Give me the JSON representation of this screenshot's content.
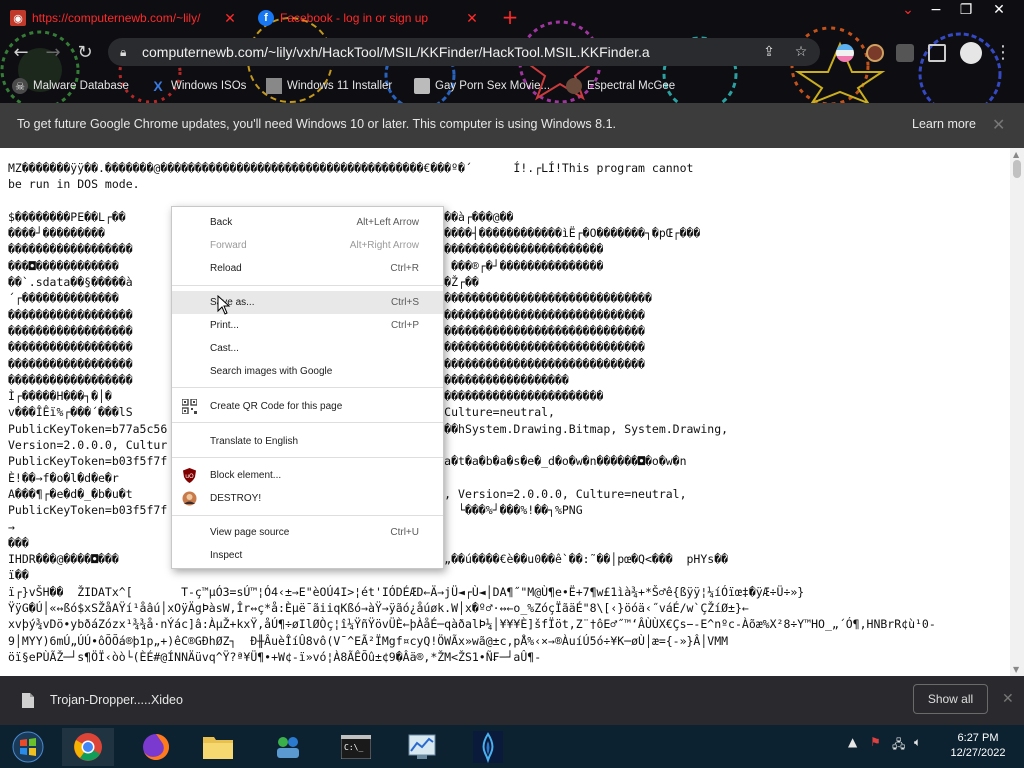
{
  "tabs": [
    {
      "title": "https://computernewb.com/~lily/",
      "favicon": "red-site-icon",
      "active": true
    },
    {
      "title": "Facebook - log in or sign up",
      "favicon": "facebook-icon",
      "active": false
    }
  ],
  "toolbar": {
    "url": "computernewb.com/~lily/vxh/HackTool/MSIL/KKFinder/HackTool.MSIL.KKFinder.a"
  },
  "bookmarks": [
    {
      "label": "Malware Database",
      "icon": "malware-skull-icon"
    },
    {
      "label": "Windows ISOs",
      "icon": "x-logo-icon"
    },
    {
      "label": "Windows 11 Installer",
      "icon": "image-thumb-icon"
    },
    {
      "label": "Gay Porn Sex Movie...",
      "icon": "site-icon"
    },
    {
      "label": "Espectral McGee",
      "icon": "avatar-icon"
    }
  ],
  "infobar": {
    "message": "To get future Google Chrome updates, you'll need Windows 10 or later. This computer is using Windows 8.1.",
    "link": "Learn more"
  },
  "page": {
    "lines": [
      "MZ�������ÿÿ��.�������@��������������������������������������€���º�´      Í!.┌LÍ!This program cannot",
      "be run in DOS mode.",
      "",
      "$��������PE��L┌��                              ��������>ì┌��  ���à┌���@��",
      "����┘���������                             ���┤��┤����┤���┼��������┤������������ìË┌�O�������┐�pŒ┌���",
      "������������������                        ��������������������������������������������",
      "���◘������������                          ����������������┐┬��  ���®┌�┘���������������",
      "��`.sdata��§�����à                        ���À.rsrc���pŒ┌���┐���Ž┌��",
      "´┌��������������                          ���������������@��B��������������������������������",
      "������������������                        ��������������������������������������������������",
      "������������������                        ��������������������������������������������������",
      "������������������                        ��������������������������������������������������",
      "������������������                        ��������������������������������������������������",
      "������������������                        ���������������������������������������",
      "Ì┌�����H���┐�│�                           ��������������������������������������������",
      "v���ÎÊï%┌���´���lS                        ib, Version=2.0.0.0, Culture=neutral,",
      "PublicKeyToken=b77a5c56                    rceSet┐���┘���┐���┘���hSystem.Drawing.Bitmap, System.Drawing,",
      "Version=2.0.0.0, Cultur                    ��┐���┐���",
      "PublicKeyToken=b03f5f7f                    ����,���Ÿ���  ┌��→d�a�t�a�b�a�s�e�_d�o�w�n������◘�o�w�n",
      "È!��→f�o�l�d�e�r                           ����→",
      "A���¶┌�e�d�_�b�u�t                        ��┐���QSystem.Drawing, Version=2.0.0.0, Culture=neutral,",
      "PublicKeyToken=b03f5f7f                    ���┘Data•┐┐���        └���%┘���%!��┐%PNG",
      "→",
      "���",
      "IHDR���@����◘���                          ���a│���  cHRM��z&��€„��ú����€è��u0��ê`��:˜��│pœ�Q<���  pHYs��",
      "ï��",
      "ï┌}vŠH��  ŽIDATx^[       T-ç™µÓ3=sÚ™¦Ó4‹±→E\"èOÚ4I>¦ét'IÓDÉÆD←Ä→jÜ◄┌Ù◄│DA¶˝\"M@Ù¶e•Ë+7¶w£1ìà¾+*Š♂ê{ßÿÿ¦¼íÓïœ‡�ÿÆ÷Ü÷»}",
      "ŸÿG�Ú│«↔ßó$xSŽåAŸí¹åâú│xOÿÄgÞàsW,Îr↔ç*å:Èµë¯ãiiqKßó→àŸ→ÿãó¿åúøk.W│x�º♂·↔←o_%ZóçÏãäÉ\"8\\[‹}öóä‹˝váÉ/w`ÇŽíØ±}←",
      "xvþý¾vDö•ybðáZózx¹¾¾å·nÝác]â:ÀµŽ+kxŸ,åÚ¶÷øIlØÒç¦î¼ŸñŸövÜÈ←þÀåÉ─qàðalÞ¼│¥¥¥È]šfÏöt,Z¨†ôE♂˝™‘ÂÙÙX€Çs−-E^nºc-Àõæ%X²8÷Y™HO_„´Ó¶,HNBrR¢ù¹0-",
      "9│MYY)6mÚ„ÚÚ•ôÕÕá®þ1p„+)êC®GÐhØZ┐  Ð╫ÂuèÎíÛ8vô(V¯^EÃ²ÏMgf¤cyQ!ÖWÃx»wã@±c,pÅ%‹×→®ÀuíÚ5ó÷¥K─øÙ│æ={-»}Â│VMM",
      "öï§ePÙÃŽ─┘s¶ÖÏ‹òò└(ÈÉ#@ÍNNÄüvq^Ÿ?ª¥Ü¶•+W¢-ï»vó¦À8ÃÊÕû±¢9�Âä®,*ŽM<ŽS1•Ñ₣─┘aÛ¶-"
    ]
  },
  "context_menu": {
    "items": [
      {
        "label": "Back",
        "shortcut": "Alt+Left Arrow",
        "disabled": false
      },
      {
        "label": "Forward",
        "shortcut": "Alt+Right Arrow",
        "disabled": true
      },
      {
        "label": "Reload",
        "shortcut": "Ctrl+R",
        "disabled": false
      },
      {
        "label": "Save as...",
        "shortcut": "Ctrl+S",
        "disabled": false,
        "highlighted": true
      },
      {
        "label": "Print...",
        "shortcut": "Ctrl+P",
        "disabled": false
      },
      {
        "label": "Cast...",
        "shortcut": "",
        "disabled": false
      },
      {
        "label": "Search images with Google",
        "shortcut": "",
        "disabled": false
      },
      {
        "label": "Create QR Code for this page",
        "shortcut": "",
        "disabled": false,
        "icon": "qr-code-icon"
      },
      {
        "label": "Translate to English",
        "shortcut": "",
        "disabled": false
      },
      {
        "label": "Block element...",
        "shortcut": "",
        "disabled": false,
        "icon": "ublock-shield-icon"
      },
      {
        "label": "DESTROY!",
        "shortcut": "",
        "disabled": false,
        "icon": "avatar-icon"
      },
      {
        "label": "View page source",
        "shortcut": "Ctrl+U",
        "disabled": false
      },
      {
        "label": "Inspect",
        "shortcut": "",
        "disabled": false
      }
    ]
  },
  "download": {
    "filename": "Trojan-Dropper.....Xideo",
    "show_all": "Show all"
  },
  "taskbar": {
    "time": "6:27 PM",
    "date": "12/27/2022"
  },
  "colors": {
    "tab_text": "#ff2a2a",
    "infobar_bg": "#3c3c3c",
    "download_bar_bg": "#2a2a2e",
    "taskbar_bg": "#0c2230"
  }
}
